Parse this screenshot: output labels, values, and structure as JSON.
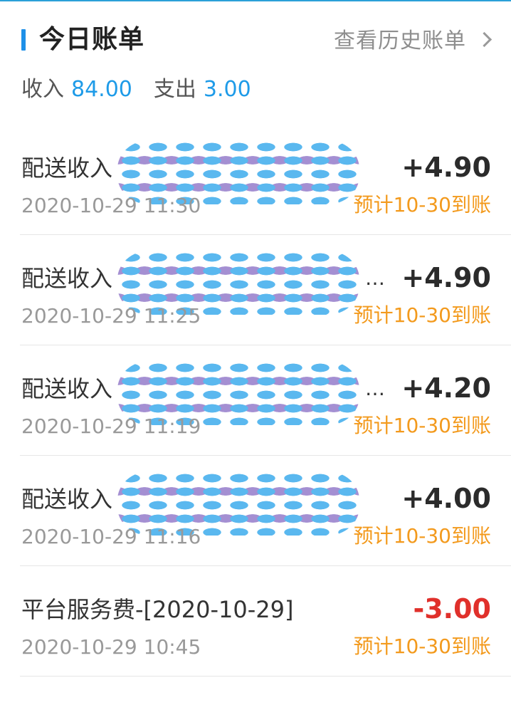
{
  "header": {
    "title": "今日账单",
    "history_link": "查看历史账单"
  },
  "summary": {
    "income_label": "收入",
    "income_value": "84.00",
    "expense_label": "支出",
    "expense_value": "3.00"
  },
  "rows": [
    {
      "title": "配送收入",
      "amount": "+4.90",
      "time": "2020-10-29 11:30",
      "status": "预计10-30到账",
      "masked": true,
      "ellipsis": ""
    },
    {
      "title": "配送收入",
      "amount": "+4.90",
      "time": "2020-10-29 11:25",
      "status": "预计10-30到账",
      "masked": true,
      "ellipsis": "…"
    },
    {
      "title": "配送收入",
      "amount": "+4.20",
      "time": "2020-10-29 11:19",
      "status": "预计10-30到账",
      "masked": true,
      "ellipsis": "…"
    },
    {
      "title": "配送收入",
      "amount": "+4.00",
      "time": "2020-10-29 11:16",
      "status": "预计10-30到账",
      "masked": true,
      "ellipsis": ""
    },
    {
      "title": "平台服务费-[2020-10-29]",
      "amount": "-3.00",
      "time": "2020-10-29 10:45",
      "status": "预计10-30到账",
      "masked": false,
      "ellipsis": ""
    }
  ],
  "colors": {
    "accent": "#1e90e8",
    "income_value": "#1e9be8",
    "negative": "#e0302b",
    "status": "#f39a1d"
  },
  "icons": {
    "history": "chevron-right-icon"
  }
}
